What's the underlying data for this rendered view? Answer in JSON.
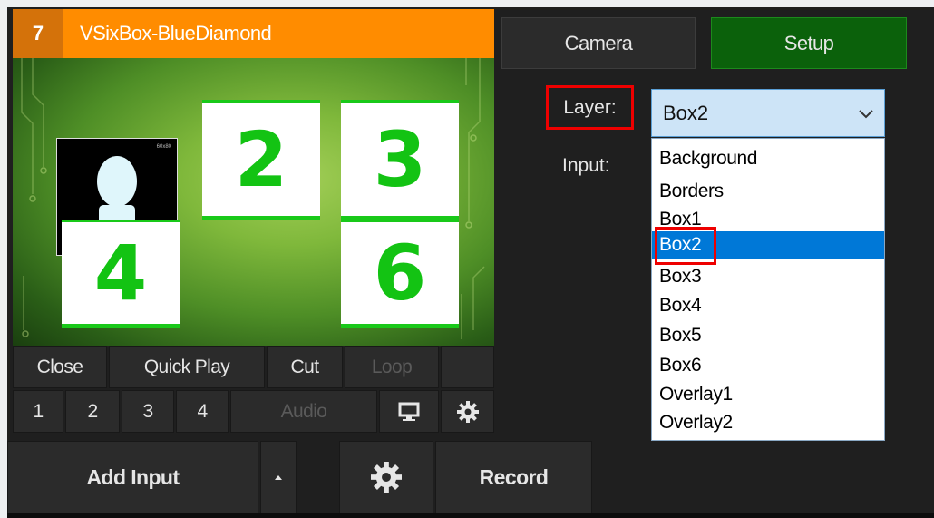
{
  "input": {
    "number": "7",
    "title": "VSixBox-BlueDiamond",
    "box_numbers": [
      "2",
      "3",
      "4",
      "6"
    ],
    "camera_tag": "60x80"
  },
  "controls": {
    "row1": [
      "Close",
      "Quick Play",
      "Cut",
      "Loop"
    ],
    "row2_numbers": [
      "1",
      "2",
      "3",
      "4"
    ],
    "audio": "Audio"
  },
  "toolbar": {
    "add_input": "Add Input",
    "record": "Record"
  },
  "right_panel": {
    "camera_tab": "Camera",
    "setup_tab": "Setup",
    "layer_label": "Layer:",
    "input_label": "Input:",
    "layer_value": "Box2",
    "layer_options": [
      "Background",
      "Borders",
      "Box1",
      "Box2",
      "Box3",
      "Box4",
      "Box5",
      "Box6",
      "Overlay1",
      "Overlay2"
    ],
    "selected_option": "Box2"
  },
  "colors": {
    "header_orange": "#ff8c00",
    "setup_green": "#0b610b",
    "selection_blue": "#0078d7",
    "highlight_red": "#e00000",
    "box_number_green": "#13c313"
  },
  "icons": [
    "chevron-down-icon",
    "monitor-icon",
    "gear-icon",
    "caret-up-icon"
  ]
}
